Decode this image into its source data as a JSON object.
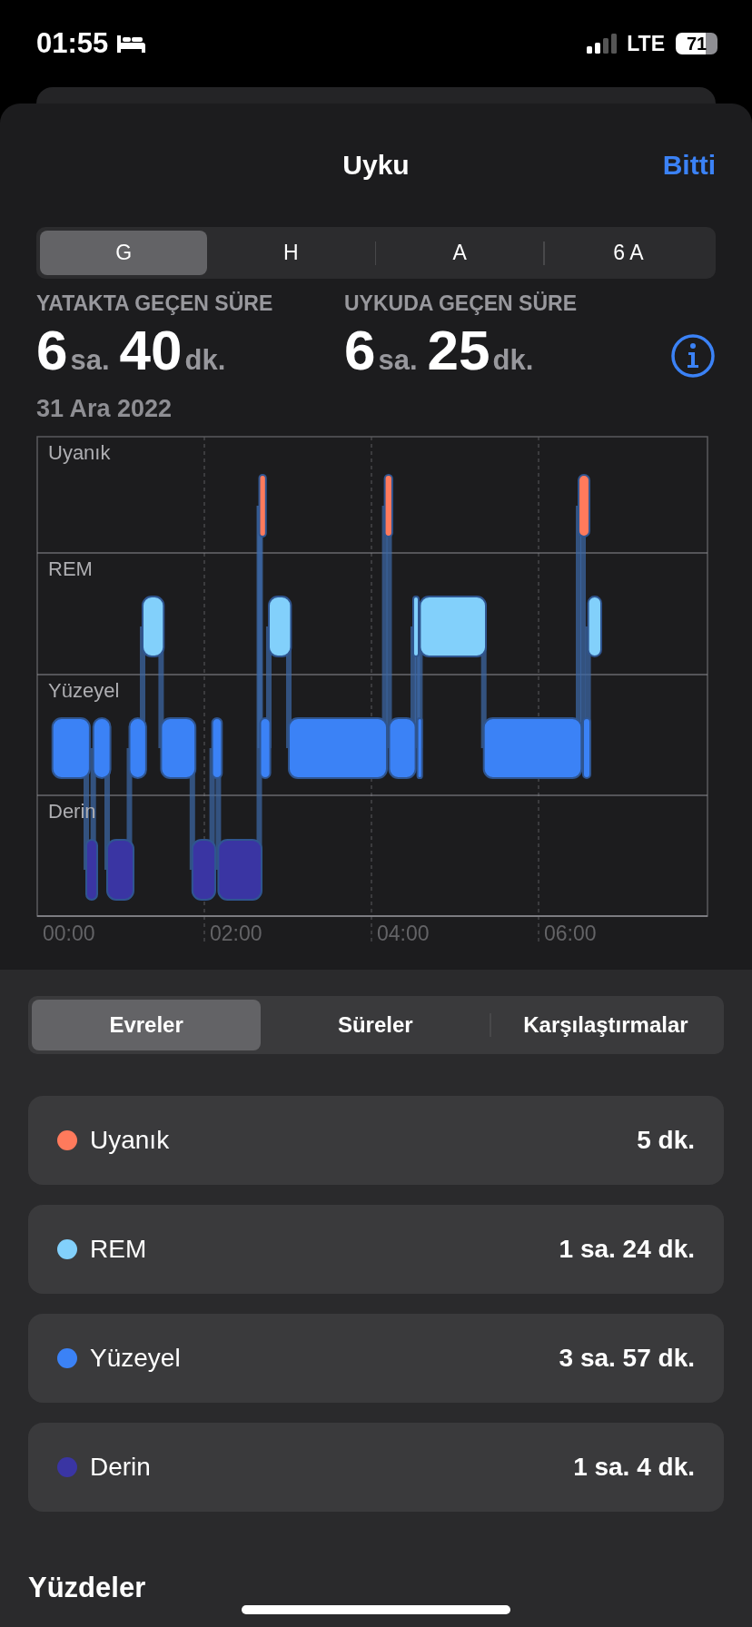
{
  "status_bar": {
    "time": "01:55",
    "network": "LTE",
    "battery": "71"
  },
  "sheet": {
    "title": "Uyku",
    "done_button": "Bitti"
  },
  "period_tabs": [
    {
      "label": "G",
      "selected": true
    },
    {
      "label": "H",
      "selected": false
    },
    {
      "label": "A",
      "selected": false
    },
    {
      "label": "6 A",
      "selected": false
    }
  ],
  "stats": [
    {
      "label": "YATAKTA GEÇEN SÜRE",
      "hours": "6",
      "hours_unit": "sa.",
      "minutes": "40",
      "minutes_unit": "dk."
    },
    {
      "label": "UYKUDA GEÇEN SÜRE",
      "hours": "6",
      "hours_unit": "sa.",
      "minutes": "25",
      "minutes_unit": "dk."
    }
  ],
  "date": "31 Ara 2022",
  "chart": {
    "stage_labels": [
      "Uyanık",
      "REM",
      "Yüzeyel",
      "Derin"
    ],
    "time_labels": [
      "00:00",
      "02:00",
      "04:00",
      "06:00"
    ]
  },
  "view_tabs": [
    {
      "label": "Evreler",
      "selected": true
    },
    {
      "label": "Süreler",
      "selected": false
    },
    {
      "label": "Karşılaştırmalar",
      "selected": false
    }
  ],
  "stages": [
    {
      "name": "Uyanık",
      "duration": "5 dk.",
      "color": "#ff7a5c"
    },
    {
      "name": "REM",
      "duration": "1 sa. 24 dk.",
      "color": "#82d0fb"
    },
    {
      "name": "Yüzeyel",
      "duration": "3 sa. 57 dk.",
      "color": "#3b82f6"
    },
    {
      "name": "Derin",
      "duration": "1 sa. 4 dk.",
      "color": "#3a35a3"
    }
  ],
  "section_title": "Yüzdeler"
}
